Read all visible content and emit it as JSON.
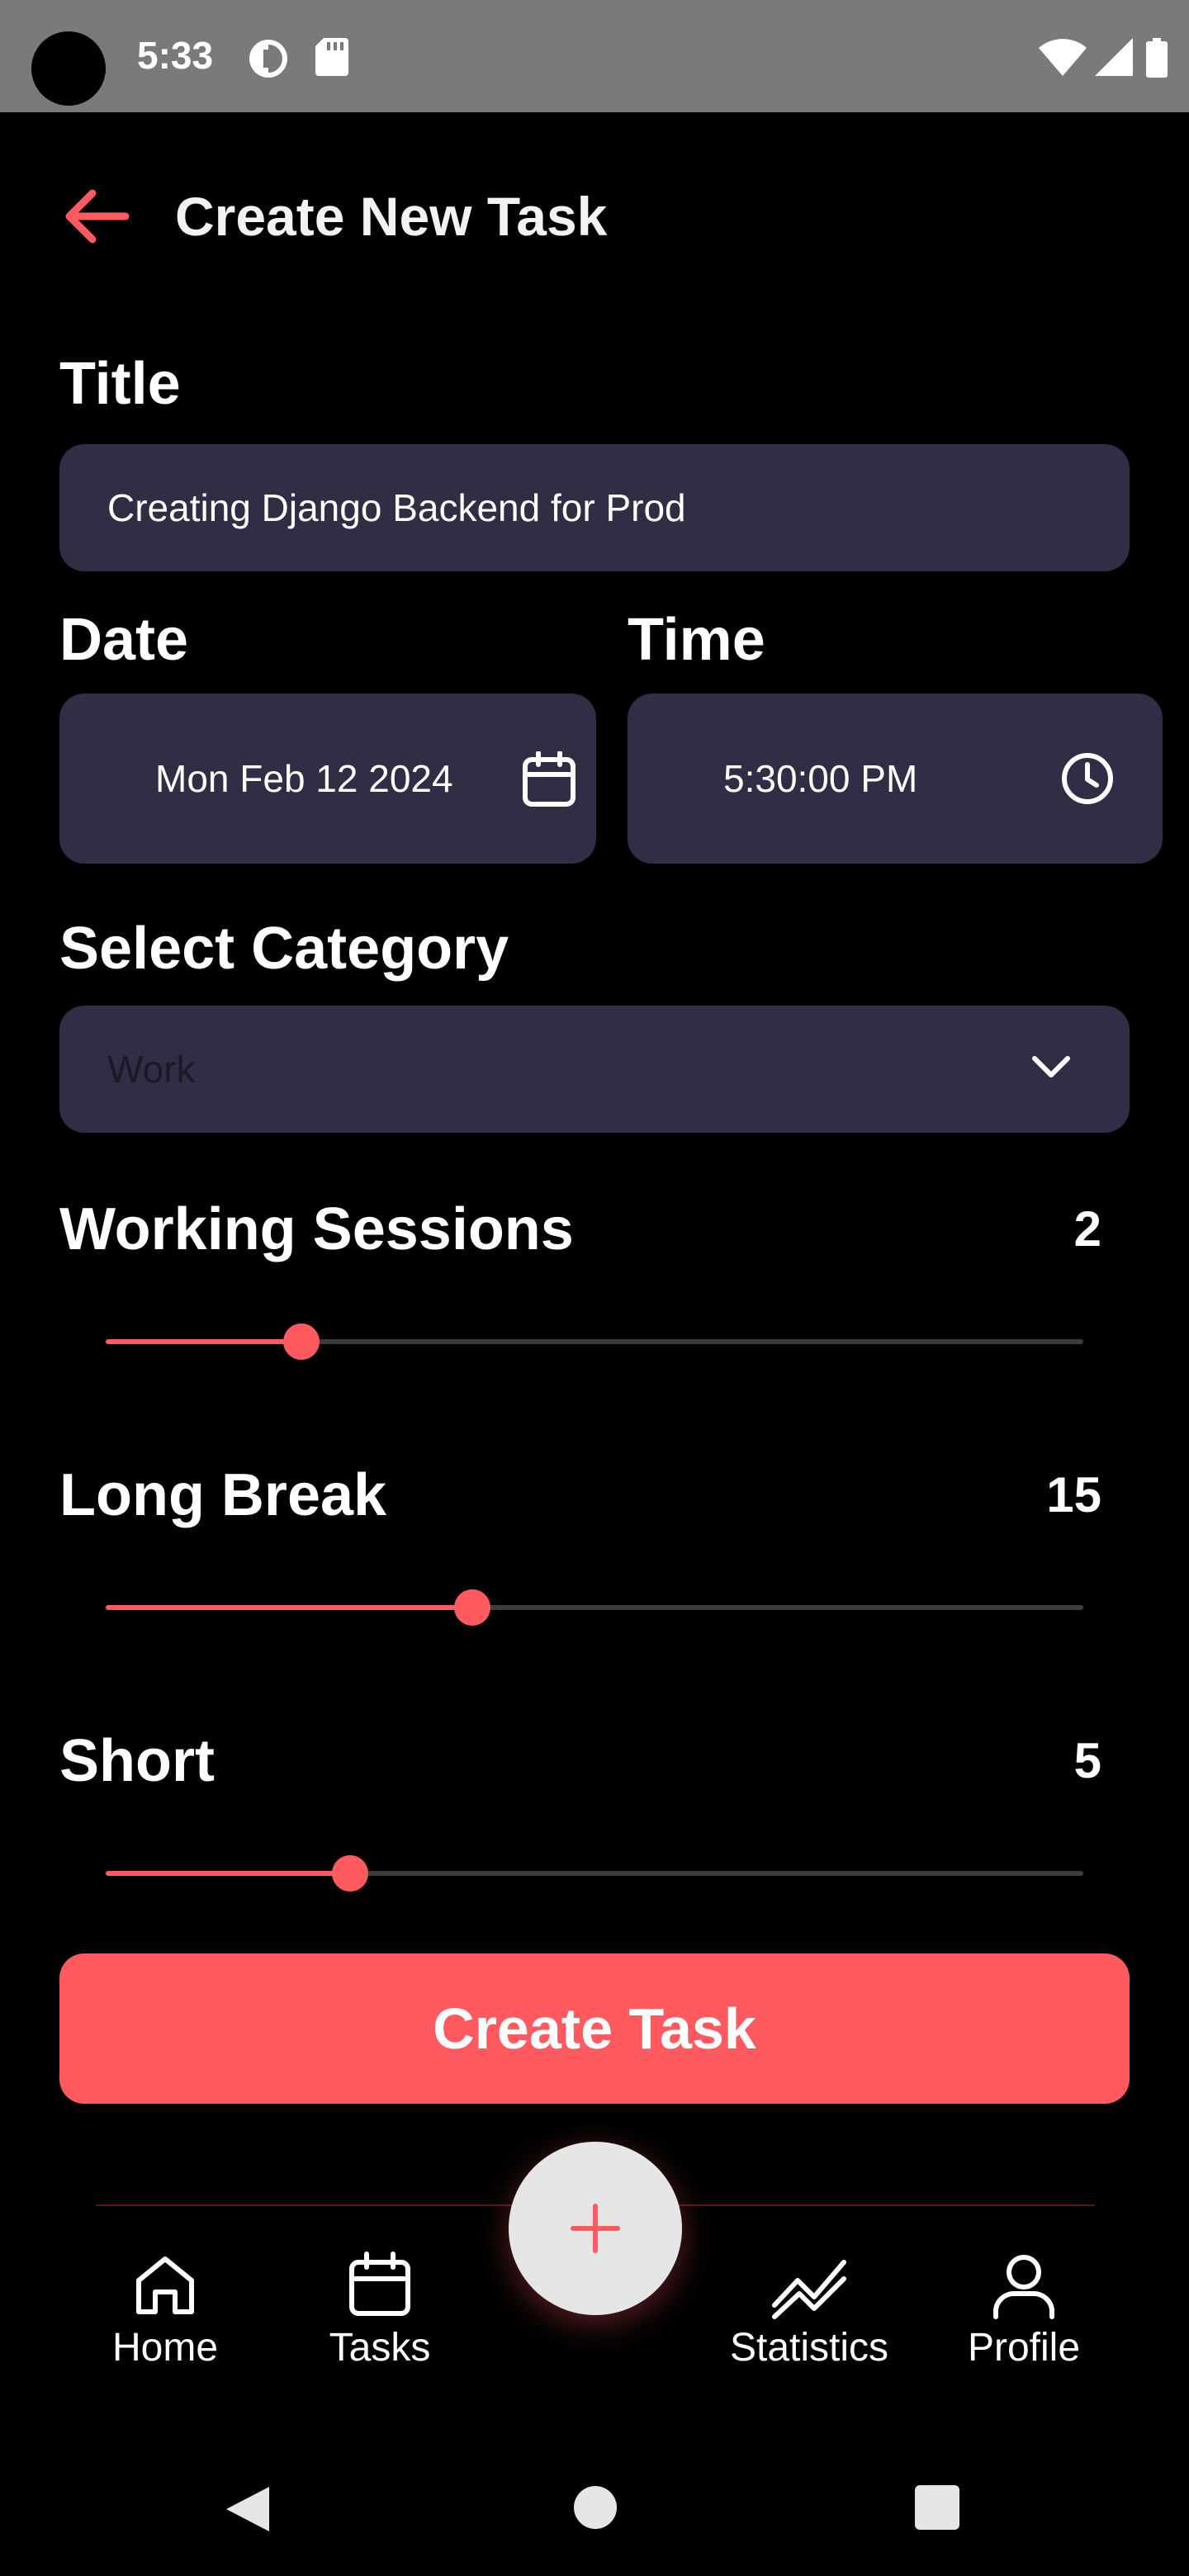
{
  "status_bar": {
    "time": "5:33"
  },
  "header": {
    "title": "Create New Task",
    "back_icon": "arrow-left-icon"
  },
  "form": {
    "title_label": "Title",
    "title_value": "Creating Django Backend for Prod",
    "date_label": "Date",
    "date_value": "Mon Feb 12 2024",
    "time_label": "Time",
    "time_value": "5:30:00 PM",
    "category_label": "Select Category",
    "category_placeholder": "Work"
  },
  "sliders": [
    {
      "label": "Working Sessions",
      "value": "2",
      "fraction": 0.2
    },
    {
      "label": "Long Break",
      "value": "15",
      "fraction": 0.375
    },
    {
      "label": "Short",
      "value": "5",
      "fraction": 0.25
    }
  ],
  "create_button": {
    "label": "Create Task"
  },
  "bottom_nav": {
    "items": [
      {
        "label": "Home",
        "icon": "home-icon"
      },
      {
        "label": "Tasks",
        "icon": "calendar-icon"
      },
      {
        "label": "Statistics",
        "icon": "chart-line-icon"
      },
      {
        "label": "Profile",
        "icon": "user-icon"
      }
    ],
    "fab_icon": "plus-icon"
  },
  "colors": {
    "accent": "#ff5a5f",
    "field_bg": "#2f2e45",
    "background": "#000000",
    "status_bar": "#7a7a7a"
  }
}
